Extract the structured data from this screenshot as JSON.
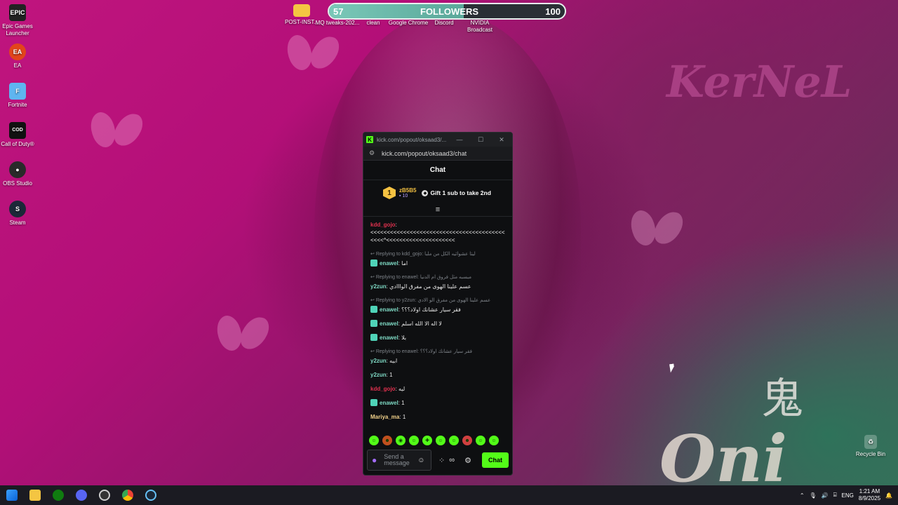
{
  "desktop_icons": [
    {
      "label": "Epic Games Launcher",
      "icon": "epic-games-icon",
      "badge": "EPIC"
    },
    {
      "label": "EA",
      "icon": "ea-icon",
      "badge": "EA"
    },
    {
      "label": "Fortnite",
      "icon": "fortnite-icon",
      "badge": "F"
    },
    {
      "label": "Call of Duty®",
      "icon": "call-of-duty-icon",
      "badge": "COD"
    },
    {
      "label": "OBS Studio",
      "icon": "obs-icon",
      "badge": "●"
    },
    {
      "label": "Steam",
      "icon": "steam-icon",
      "badge": "S"
    }
  ],
  "top_icons": [
    {
      "label": "POST-INST...",
      "icon": "folder-icon"
    },
    {
      "label": "MQ tweaks-202...",
      "icon": "file-icon"
    },
    {
      "label": "clean",
      "icon": "file-icon"
    },
    {
      "label": "Google Chrome",
      "icon": "chrome-icon"
    },
    {
      "label": "Discord",
      "icon": "discord-icon"
    },
    {
      "label": "NVIDIA Broadcast",
      "icon": "nvidia-icon"
    }
  ],
  "recycle_bin": {
    "label": "Recycle Bin"
  },
  "followers": {
    "current": "57",
    "label": "FOLLOWERS",
    "goal": "100",
    "progress": 0.57
  },
  "wallpaper": {
    "brand": "KerNeL",
    "kanji": "鬼",
    "script": "Oni"
  },
  "chat_window": {
    "title": "kick.com/popout/oksaad3/...",
    "url": "kick.com/popout/oksaad3/chat",
    "header": "Chat",
    "pinned": {
      "rank": "1",
      "user": "zB5B5",
      "subs": "10",
      "gift_text": "Gift 1 sub to take 2nd"
    },
    "messages": [
      {
        "user": "kdd_gojo",
        "color": "red",
        "reply": "",
        "text": "<<<<<<<<<<<<<<<<<<<<<<<<<<<<<<<<<<<<<<<<<<<<<^<<<<<<<<<<<<<<<<<<<<<",
        "badge": false
      },
      {
        "user": "enawel",
        "color": "teal",
        "reply": "Replying to kdd_gojo: ليتا عشوائيه الكل من ملبا",
        "text": "اما",
        "badge": true
      },
      {
        "user": "y2zun",
        "color": "teal",
        "reply": "Replying to enawel: مبسبه مثل فروق ام الدنيا",
        "text": "عسم علينا الهوى من مفرق الوااادي",
        "badge": false
      },
      {
        "user": "enawel",
        "color": "teal",
        "reply": "Replying to y2zun: عسم علينا الهوى من مفرق الو الادي",
        "text": "فقر سيار عشانك اولاد؟؟؟",
        "badge": true
      },
      {
        "user": "enawel",
        "color": "teal",
        "reply": "",
        "text": "لا اله الا الله اسلم",
        "badge": true
      },
      {
        "user": "enawel",
        "color": "teal",
        "reply": "",
        "text": "بلا",
        "badge": true
      },
      {
        "user": "y2zun",
        "color": "teal",
        "reply": "Replying to enawel: فقر سيار عشانك اولاد؟؟؟",
        "text": "ابيه",
        "badge": false
      },
      {
        "user": "y2zun",
        "color": "teal",
        "reply": "",
        "text": "1",
        "badge": false
      },
      {
        "user": "kdd_gojo",
        "color": "red",
        "reply": "",
        "text": "ليه",
        "badge": false
      },
      {
        "user": "enawel",
        "color": "teal",
        "reply": "",
        "text": "1",
        "badge": true
      },
      {
        "user": "Mariya_ma",
        "color": "gold",
        "reply": "",
        "text": "1",
        "badge": false
      }
    ],
    "input_placeholder": "Send a message",
    "send_label": "Chat"
  },
  "taskbar": {
    "apps": [
      "windows-start-icon",
      "file-explorer-icon",
      "xbox-icon",
      "discord-icon",
      "obs-icon",
      "chrome-icon",
      "steam-icon"
    ],
    "language": "ENG",
    "time": "1:21 AM",
    "date": "8/9/2025"
  }
}
